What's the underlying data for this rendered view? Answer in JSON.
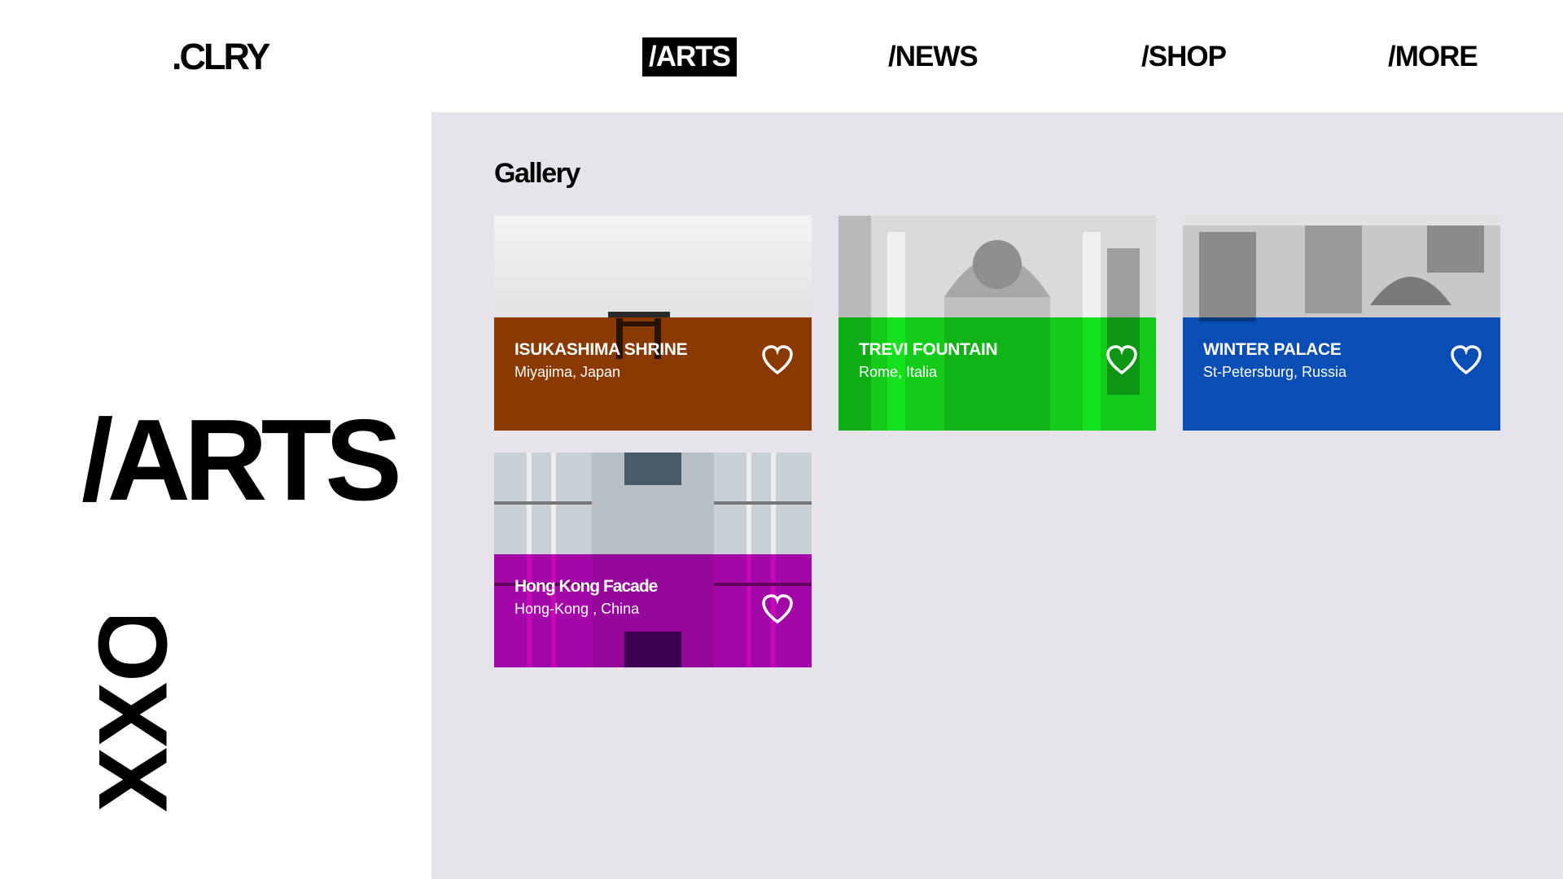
{
  "header": {
    "logo": ".CLRY",
    "nav": [
      {
        "label": "/ARTS",
        "active": true
      },
      {
        "label": "/NEWS",
        "active": false
      },
      {
        "label": "/SHOP",
        "active": false
      },
      {
        "label": "/MORE",
        "active": false
      }
    ]
  },
  "sidebar": {
    "title": "/ARTS",
    "mark": "XXO"
  },
  "main": {
    "section_title": "Gallery",
    "cards": [
      {
        "title": "ISUKASHIMA SHRINE",
        "location": "Miyajima, Japan",
        "color": "#ff6a00",
        "icon": "heart-icon"
      },
      {
        "title": "TREVI FOUNTAIN",
        "location": "Rome, Italia",
        "color": "#16f01e",
        "icon": "heart-icon"
      },
      {
        "title": "WINTER PALACE",
        "location": "St-Petersburg, Russia",
        "color": "#0b63e6",
        "icon": "heart-icon"
      },
      {
        "title": "Hong Kong Facade",
        "location": "Hong-Kong , China",
        "color": "#d008c8",
        "icon": "heart-icon"
      }
    ]
  }
}
